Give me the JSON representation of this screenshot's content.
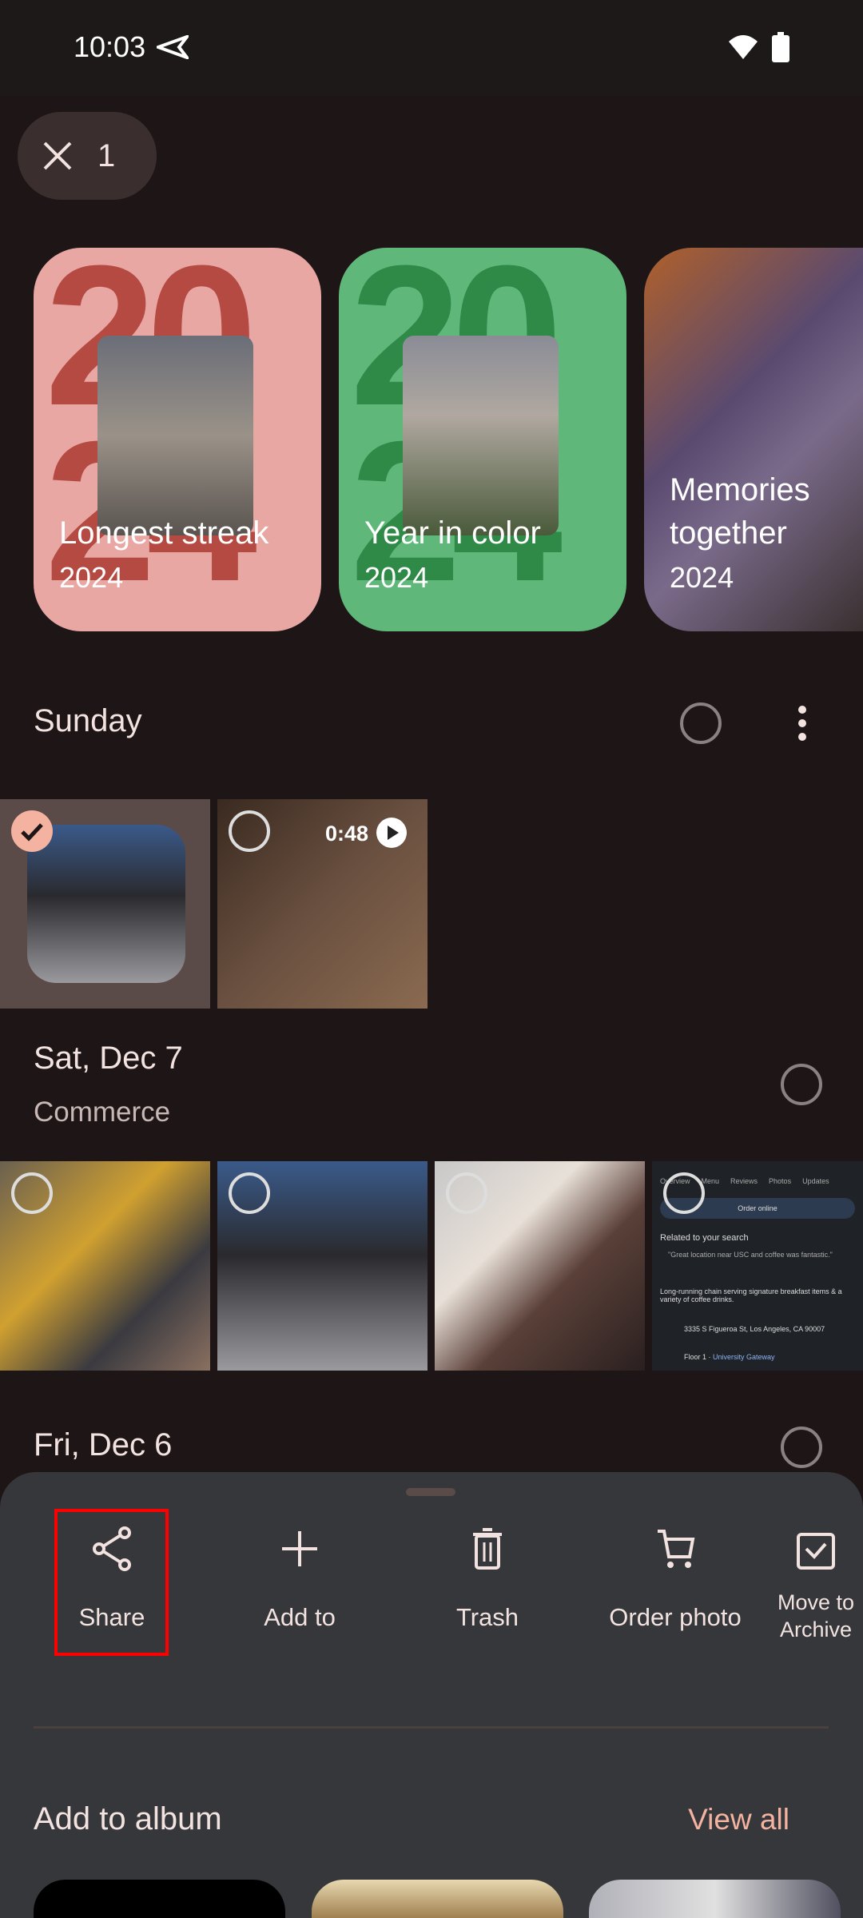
{
  "status_bar": {
    "time": "10:03"
  },
  "selection": {
    "count": "1"
  },
  "memories": [
    {
      "title": "Longest streak",
      "year": "2024",
      "color": "#e8a7a3"
    },
    {
      "title": "Year in color",
      "year": "2024",
      "color": "#5fb87a"
    },
    {
      "title": "Memories together",
      "year": "2024"
    }
  ],
  "sections": [
    {
      "title": "Sunday",
      "video_duration": "0:48"
    },
    {
      "title": "Sat, Dec 7",
      "subtitle": "Commerce"
    },
    {
      "title": "Fri, Dec 6"
    }
  ],
  "screenshot_thumb": {
    "tabs": [
      "Overview",
      "Menu",
      "Reviews",
      "Photos",
      "Updates"
    ],
    "order": "Order online",
    "related": "Related to your search",
    "quote": "\"Great location near USC and coffee was fantastic.\"",
    "desc": "Long-running chain serving signature breakfast items & a variety of coffee drinks.",
    "address": "3335 S Figueroa St, Los Angeles, CA 90007",
    "floor": "Floor 1 · ",
    "place": "University Gateway"
  },
  "actions": [
    {
      "label": "Share"
    },
    {
      "label": "Add to"
    },
    {
      "label": "Trash"
    },
    {
      "label": "Order photo"
    },
    {
      "label": "Move to Archive"
    }
  ],
  "album": {
    "title": "Add to album",
    "view_all": "View all"
  },
  "colors": {
    "accent": "#f4b2a0",
    "sheet": "#36373b",
    "highlight": "#ff0000"
  }
}
